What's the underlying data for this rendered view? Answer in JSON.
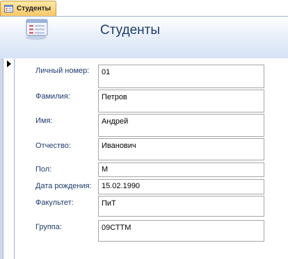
{
  "tab": {
    "label": "Студенты",
    "icon": "form-icon",
    "active_color": "#f7c768"
  },
  "form": {
    "title": "Студенты",
    "header_icon": "form-icon"
  },
  "record_selector": {
    "icon": "current-record-arrow-icon"
  },
  "fields": {
    "personal_number": {
      "label": "Личный номер:",
      "value": "01"
    },
    "last_name": {
      "label": "Фамилия:",
      "value": "Петров"
    },
    "first_name": {
      "label": "Имя:",
      "value": "Андрей"
    },
    "patronymic": {
      "label": "Отчество:",
      "value": "Иванович"
    },
    "gender": {
      "label": "Пол:",
      "value": "М"
    },
    "birth_date": {
      "label": "Дата рождения:",
      "value": "15.02.1990"
    },
    "faculty": {
      "label": "Факультет:",
      "value": "ПиТ"
    },
    "group": {
      "label": "Группа:",
      "value": "09СТТМ"
    }
  },
  "colors": {
    "label_text": "#1e3c6e",
    "title_text": "#1e3c6e",
    "header_band": "#d6e3f5"
  }
}
